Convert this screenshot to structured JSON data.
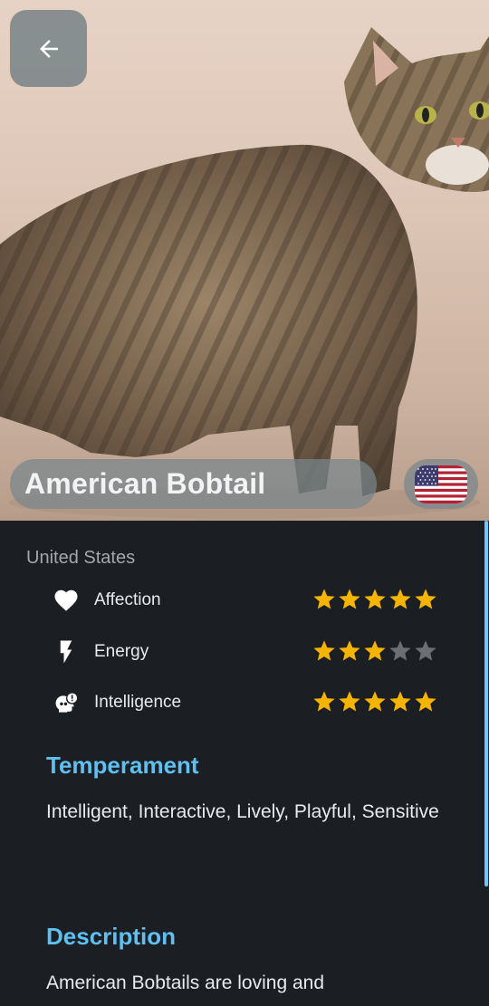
{
  "breed": {
    "name": "American Bobtail",
    "origin": "United States"
  },
  "stats": [
    {
      "label": "Affection",
      "icon": "heart-icon",
      "rating": 5,
      "max": 5
    },
    {
      "label": "Energy",
      "icon": "lightning-bolt-icon",
      "rating": 3,
      "max": 5
    },
    {
      "label": "Intelligence",
      "icon": "brain-alert-icon",
      "rating": 5,
      "max": 5
    }
  ],
  "sections": {
    "temperament_title": "Temperament",
    "temperament_text": "Intelligent, Interactive, Lively, Playful, Sensitive",
    "description_title": "Description",
    "description_text": "American Bobtails are loving and"
  },
  "colors": {
    "accent": "#5ebff0",
    "star_filled": "#f5b400",
    "star_empty": "#6b6f73",
    "background": "#1b1e22"
  },
  "icons": {
    "back": "arrow-left-icon",
    "flag": "us-flag-icon"
  }
}
